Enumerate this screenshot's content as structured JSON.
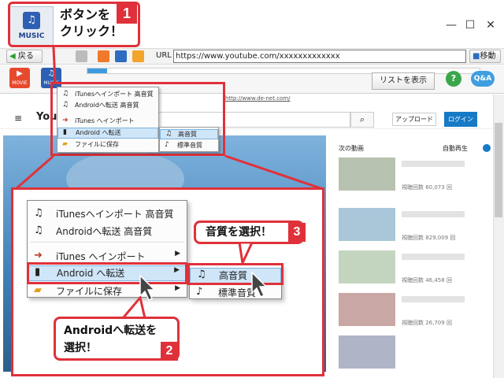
{
  "window": {
    "minimize": "—",
    "maximize": "☐",
    "close": "✕"
  },
  "nav": {
    "back_label": "戻る",
    "url_label": "URL",
    "url_value": "https://www.youtube.com/xxxxxxxxxxxxx",
    "go_label": "移動"
  },
  "toolbar": {
    "movie_label": "MOVIE",
    "music_label": "MUSIC",
    "list_label": "リストを表示",
    "progress": 0.05
  },
  "site": {
    "url_text": "http://www.de-net.com/"
  },
  "youtube": {
    "logo": "You",
    "upload": "アップロード",
    "login": "ログイン",
    "next_videos": "次の動画",
    "autoplay": "自動再生"
  },
  "related": [
    {
      "views": "視聴回数 60,073 回"
    },
    {
      "views": "視聴回数 829,009 回"
    },
    {
      "views": "視聴回数 46,458 回"
    },
    {
      "views": "視聴回数 26,709 回"
    }
  ],
  "small_menu": {
    "items": [
      "iTunesへインポート 高音質",
      "Androidへ転送 高音質",
      "iTunes へインポート",
      "Android へ転送",
      "ファイルに保存"
    ],
    "sub": [
      "高音質",
      "標準音質"
    ]
  },
  "zoom_menu": {
    "items": [
      "iTunesへインポート 高音質",
      "Androidへ転送 高音質",
      "iTunes へインポート",
      "Android へ転送",
      "ファイルに保存"
    ],
    "sub": [
      "高音質",
      "標準音質"
    ]
  },
  "callouts": {
    "step1": "ボタンを\nクリック！",
    "step2": "Androidへ転送を\n選択！",
    "step3": "音質を選択！",
    "num1": "1",
    "num2": "2",
    "num3": "3"
  },
  "colors": {
    "accent_red": "#e0313a",
    "highlight": "#cfe5f8"
  }
}
